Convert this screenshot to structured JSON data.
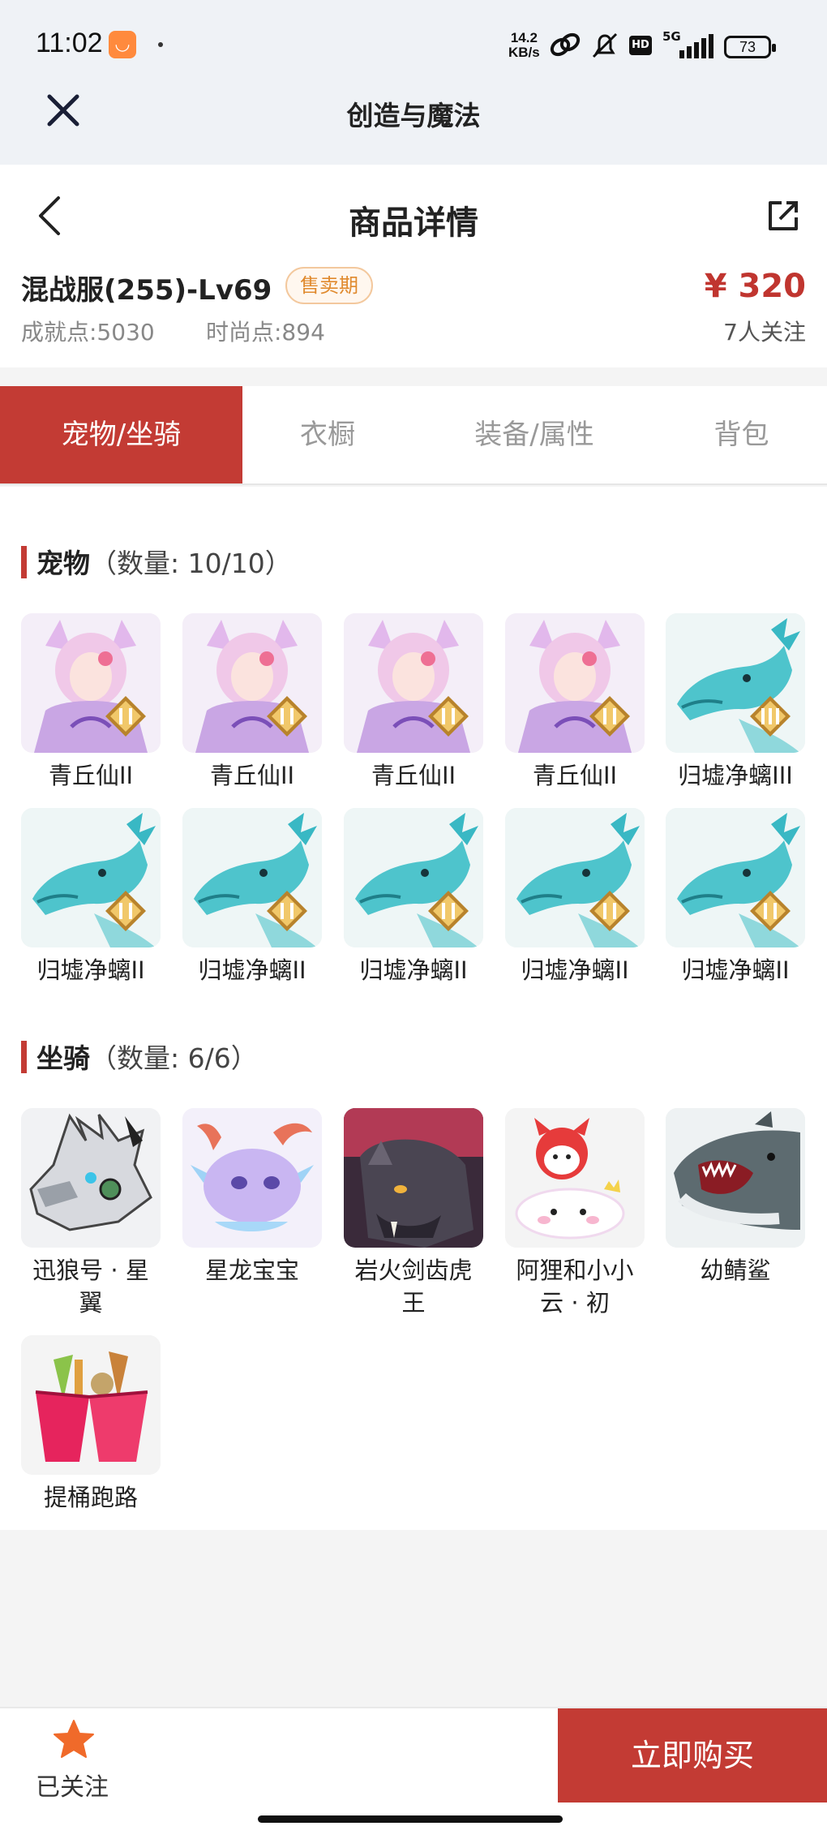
{
  "status": {
    "time": "11:02",
    "net_speed_top": "14.2",
    "net_speed_bottom": "KB/s",
    "network": "5G",
    "hd": "HD",
    "battery": "73"
  },
  "miniapp": {
    "title": "创造与魔法"
  },
  "header": {
    "title": "商品详情"
  },
  "item": {
    "name": "混战服(255)-Lv69",
    "badge": "售卖期",
    "price": "¥ 320",
    "achievement": "成就点:5030",
    "fashion": "时尚点:894",
    "followers": "7人关注"
  },
  "tabs": [
    {
      "label": "宠物/坐骑"
    },
    {
      "label": "衣橱"
    },
    {
      "label": "装备/属性"
    },
    {
      "label": "背包"
    }
  ],
  "pets": {
    "title": "宠物",
    "count": "（数量: 10/10）",
    "items": [
      {
        "label": "青丘仙II"
      },
      {
        "label": "青丘仙II"
      },
      {
        "label": "青丘仙II"
      },
      {
        "label": "青丘仙II"
      },
      {
        "label": "归墟净螭III"
      },
      {
        "label": "归墟净螭II"
      },
      {
        "label": "归墟净螭II"
      },
      {
        "label": "归墟净螭II"
      },
      {
        "label": "归墟净螭II"
      },
      {
        "label": "归墟净螭II"
      }
    ]
  },
  "mounts": {
    "title": "坐骑",
    "count": "（数量: 6/6）",
    "items": [
      {
        "label": "迅狼号 · 星翼"
      },
      {
        "label": "星龙宝宝"
      },
      {
        "label": "岩火剑齿虎王"
      },
      {
        "label": "阿狸和小小云 · 初"
      },
      {
        "label": "幼鲭鲨"
      },
      {
        "label": "提桶跑路"
      }
    ]
  },
  "bottom": {
    "follow_label": "已关注",
    "buy_label": "立即购买"
  },
  "colors": {
    "accent": "#c33b34",
    "badge": "#e08a2e"
  }
}
